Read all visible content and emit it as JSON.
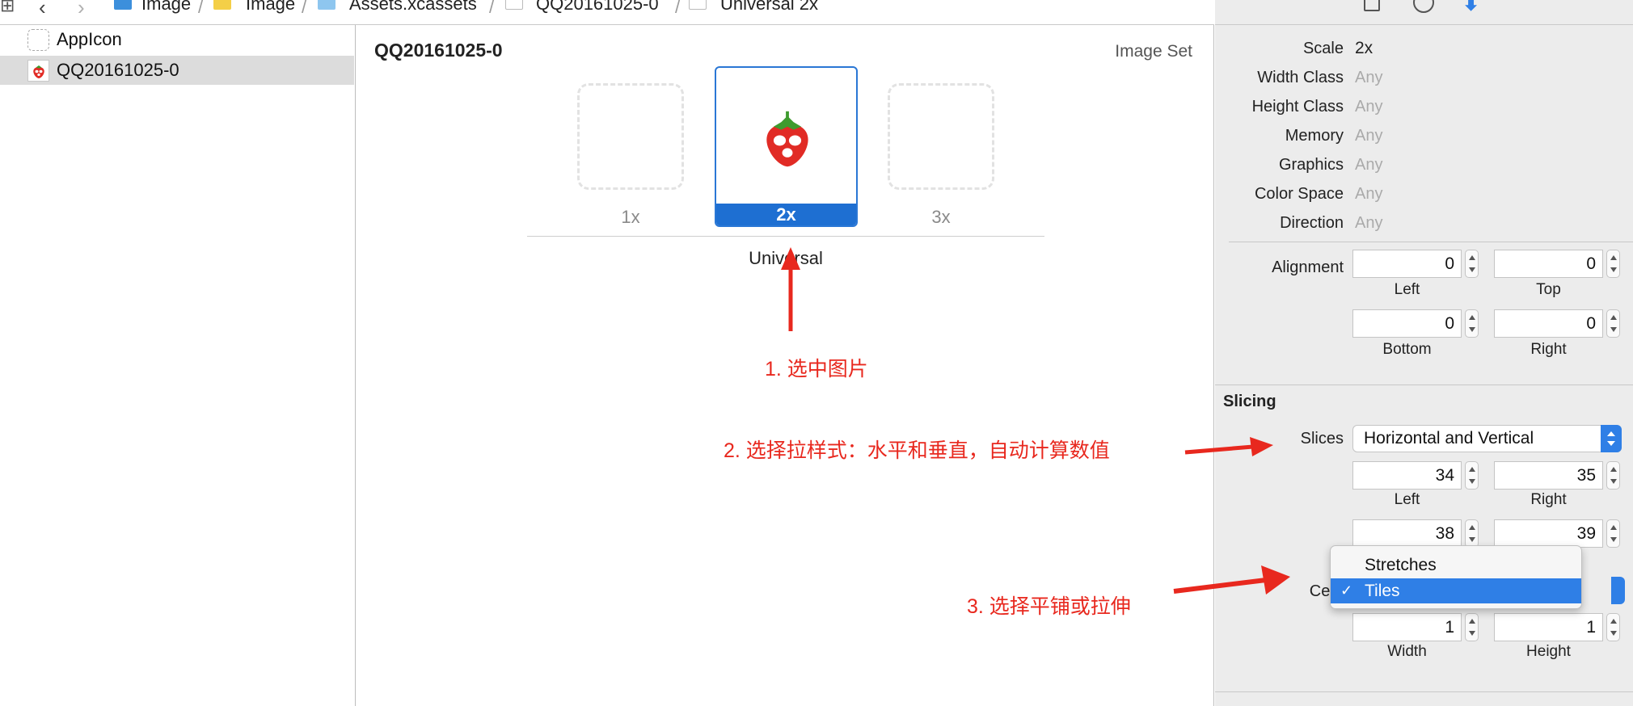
{
  "breadcrumb": {
    "items": [
      "Image",
      "Image",
      "Assets.xcassets",
      "QQ20161025-0",
      "Universal 2x"
    ]
  },
  "navigator": {
    "items": [
      {
        "label": "AppIcon"
      },
      {
        "label": "QQ20161025-0",
        "selected": true
      }
    ]
  },
  "editor": {
    "asset_name": "QQ20161025-0",
    "asset_kind": "Image Set",
    "slots": [
      "1x",
      "2x",
      "3x"
    ],
    "selected_slot": "2x",
    "idiom_label": "Universal"
  },
  "inspector": {
    "properties": [
      {
        "key": "Scale",
        "value": "2x"
      },
      {
        "key": "Width Class",
        "value": "Any"
      },
      {
        "key": "Height Class",
        "value": "Any"
      },
      {
        "key": "Memory",
        "value": "Any"
      },
      {
        "key": "Graphics",
        "value": "Any"
      },
      {
        "key": "Color Space",
        "value": "Any"
      },
      {
        "key": "Direction",
        "value": "Any"
      }
    ],
    "alignment": {
      "label": "Alignment",
      "left": "0",
      "top": "0",
      "bottom": "0",
      "right": "0",
      "left_label": "Left",
      "top_label": "Top",
      "bottom_label": "Bottom",
      "right_label": "Right"
    },
    "slicing": {
      "header": "Slicing",
      "slices_label": "Slices",
      "slices_value": "Horizontal and Vertical",
      "left": "34",
      "right": "35",
      "top": "38",
      "bottom": "39",
      "left_label": "Left",
      "right_label": "Right",
      "center_label": "Cent",
      "center_options": [
        "Stretches",
        "Tiles"
      ],
      "center_selected": "Tiles",
      "width": "1",
      "height": "1",
      "width_label": "Width",
      "height_label": "Height"
    }
  },
  "annotations": {
    "step1": "1. 选中图片",
    "step2": "2. 选择拉样式：水平和垂直，自动计算数值",
    "step3": "3. 选择平铺或拉伸"
  },
  "colors": {
    "accent": "#1e6fd2",
    "annotation": "#e8281e",
    "inspector_bg": "#ececec"
  }
}
